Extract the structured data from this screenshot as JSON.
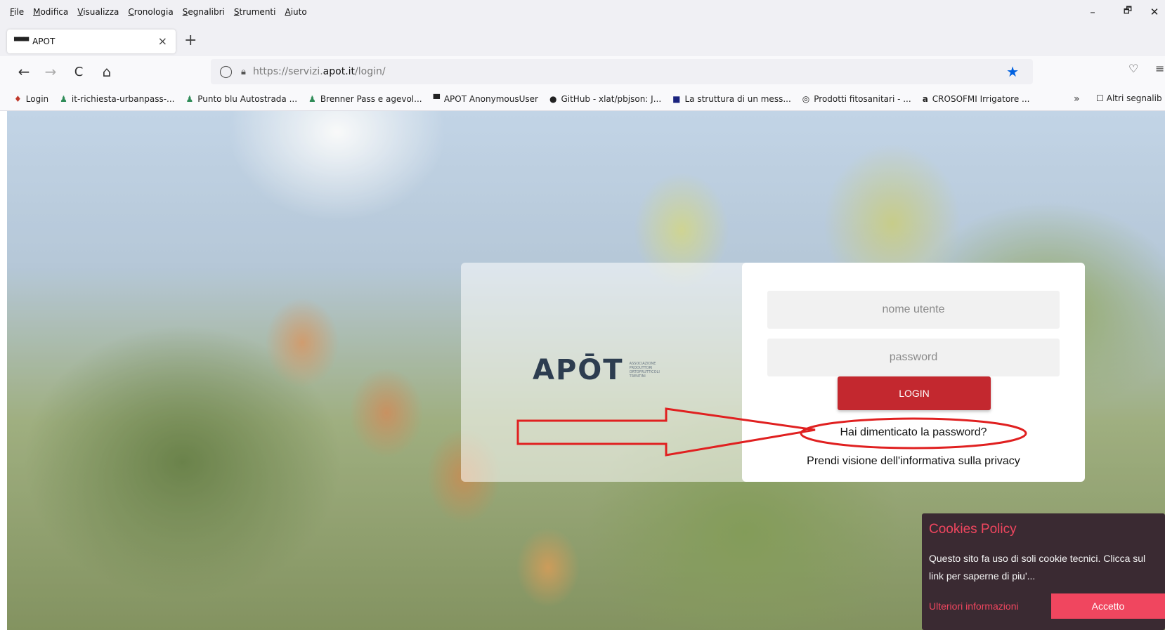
{
  "menubar": {
    "items": [
      "File",
      "Modifica",
      "Visualizza",
      "Cronologia",
      "Segnalibri",
      "Strumenti",
      "Aiuto"
    ],
    "minimize": "–",
    "restore": "🗗",
    "close": "✕"
  },
  "tab": {
    "favicon": "▀▀▀",
    "title": "APOT",
    "close": "×",
    "new_tab": "+"
  },
  "nav": {
    "back": "←",
    "forward": "→",
    "reload": "C",
    "home": "⌂",
    "url_prefix": "https://servizi.",
    "url_host": "apot.it",
    "url_path": "/login/",
    "star": "★",
    "pocket": "♡",
    "menu": "≡"
  },
  "bookmarks": {
    "items": [
      {
        "icon": "♦",
        "label": "Login"
      },
      {
        "icon": "♟",
        "label": "it-richiesta-urbanpass-..."
      },
      {
        "icon": "♟",
        "label": "Punto blu Autostrada ..."
      },
      {
        "icon": "♟",
        "label": "Brenner Pass e agevol..."
      },
      {
        "icon": "▀",
        "label": "APOT AnonymousUser"
      },
      {
        "icon": "●",
        "label": "GitHub - xlat/pbjson: J..."
      },
      {
        "icon": "■",
        "label": "La struttura di un mess..."
      },
      {
        "icon": "◎",
        "label": "Prodotti fitosanitari - ..."
      },
      {
        "icon": "a",
        "label": "CROSOFMI Irrigatore ..."
      }
    ],
    "more": "»",
    "other_icon": "☐",
    "other": "Altri segnalib"
  },
  "login": {
    "logo_main": "APŌT",
    "logo_sub": "ASSOCIAZIONE PRODUTTORI ORTOFRUTTICOLI TRENTINI",
    "username_placeholder": "nome utente",
    "password_placeholder": "password",
    "login_button": "LOGIN",
    "forgot_password": "Hai dimenticato la password?",
    "privacy": "Prendi visione dell'informativa sulla privacy"
  },
  "annotation": {
    "color": "#e02020"
  },
  "cookie": {
    "title": "Cookies Policy",
    "text": "Questo sito fa uso di soli cookie tecnici. Clicca sul link per saperne di piu'...",
    "more": "Ulteriori informazioni",
    "accept": "Accetto"
  }
}
